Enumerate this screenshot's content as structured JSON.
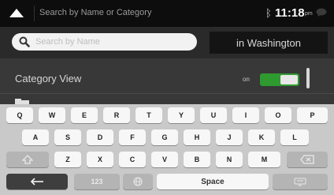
{
  "header": {
    "menu_icon": "triangle-up-icon",
    "title": "Search by Name or Category",
    "bluetooth_icon": "bluetooth-icon",
    "time": "11:18",
    "ampm": "pm",
    "message_icon": "speech-bubble-icon"
  },
  "search": {
    "placeholder": "Search by Name",
    "value": "",
    "location_label": "in Washington"
  },
  "category": {
    "label": "Category View",
    "toggle_state": "on"
  },
  "keyboard": {
    "row1": [
      "Q",
      "W",
      "E",
      "R",
      "T",
      "Y",
      "U",
      "I",
      "O",
      "P"
    ],
    "row2": [
      "A",
      "S",
      "D",
      "F",
      "G",
      "H",
      "J",
      "K",
      "L"
    ],
    "row3": [
      "Z",
      "X",
      "C",
      "V",
      "B",
      "N",
      "M"
    ],
    "numbers_label": "123",
    "space_label": "Space",
    "shift_icon": "shift-arrow-icon",
    "backspace_icon": "backspace-icon",
    "back_icon": "left-arrow-icon",
    "globe_icon": "globe-icon",
    "keyboard_hide_icon": "keyboard-hide-icon"
  }
}
